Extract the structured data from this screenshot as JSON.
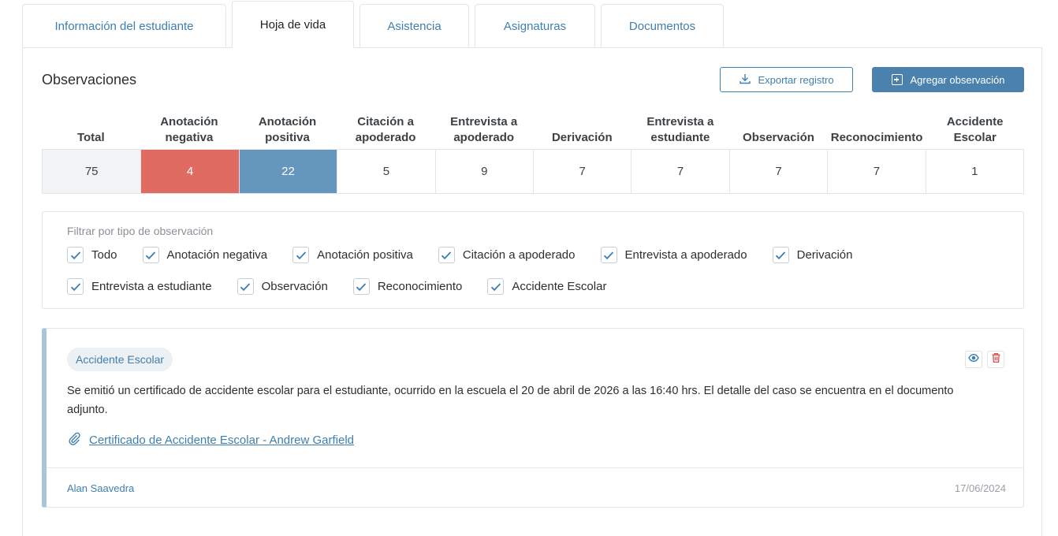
{
  "tabs": [
    {
      "label": "Información del estudiante",
      "active": false
    },
    {
      "label": "Hoja de vida",
      "active": true
    },
    {
      "label": "Asistencia",
      "active": false
    },
    {
      "label": "Asignaturas",
      "active": false
    },
    {
      "label": "Documentos",
      "active": false
    }
  ],
  "section_title": "Observaciones",
  "buttons": {
    "export_label": "Exportar registro",
    "add_label": "Agregar observación"
  },
  "stats": {
    "headers": [
      "Total",
      "Anotación negativa",
      "Anotación positiva",
      "Citación a apoderado",
      "Entrevista a apoderado",
      "Derivación",
      "Entrevista a estudiante",
      "Observación",
      "Reconocimiento",
      "Accidente Escolar"
    ],
    "values": [
      "75",
      "4",
      "22",
      "5",
      "9",
      "7",
      "7",
      "7",
      "7",
      "1"
    ]
  },
  "filter": {
    "title": "Filtrar por tipo de observación",
    "options_row1": [
      "Todo",
      "Anotación negativa",
      "Anotación positiva",
      "Citación a apoderado",
      "Entrevista a apoderado",
      "Derivación"
    ],
    "options_row2": [
      "Entrevista a estudiante",
      "Observación",
      "Reconocimiento",
      "Accidente Escolar"
    ],
    "all_checked": true
  },
  "observation": {
    "tag": "Accidente Escolar",
    "text": "Se emitió un certificado de accidente escolar para el estudiante, ocurrido en la escuela el 20 de abril de 2026 a las 16:40 hrs. El detalle del caso se encuentra en el documento adjunto.",
    "attachment": "Certificado de Accidente Escolar - Andrew Garfield",
    "author": "Alan Saavedra",
    "date": "17/06/2024"
  },
  "colors": {
    "accent": "#3f7fb0",
    "negative": "#df6b63",
    "positive": "#6596bb",
    "primary_button": "#4a82ad"
  }
}
